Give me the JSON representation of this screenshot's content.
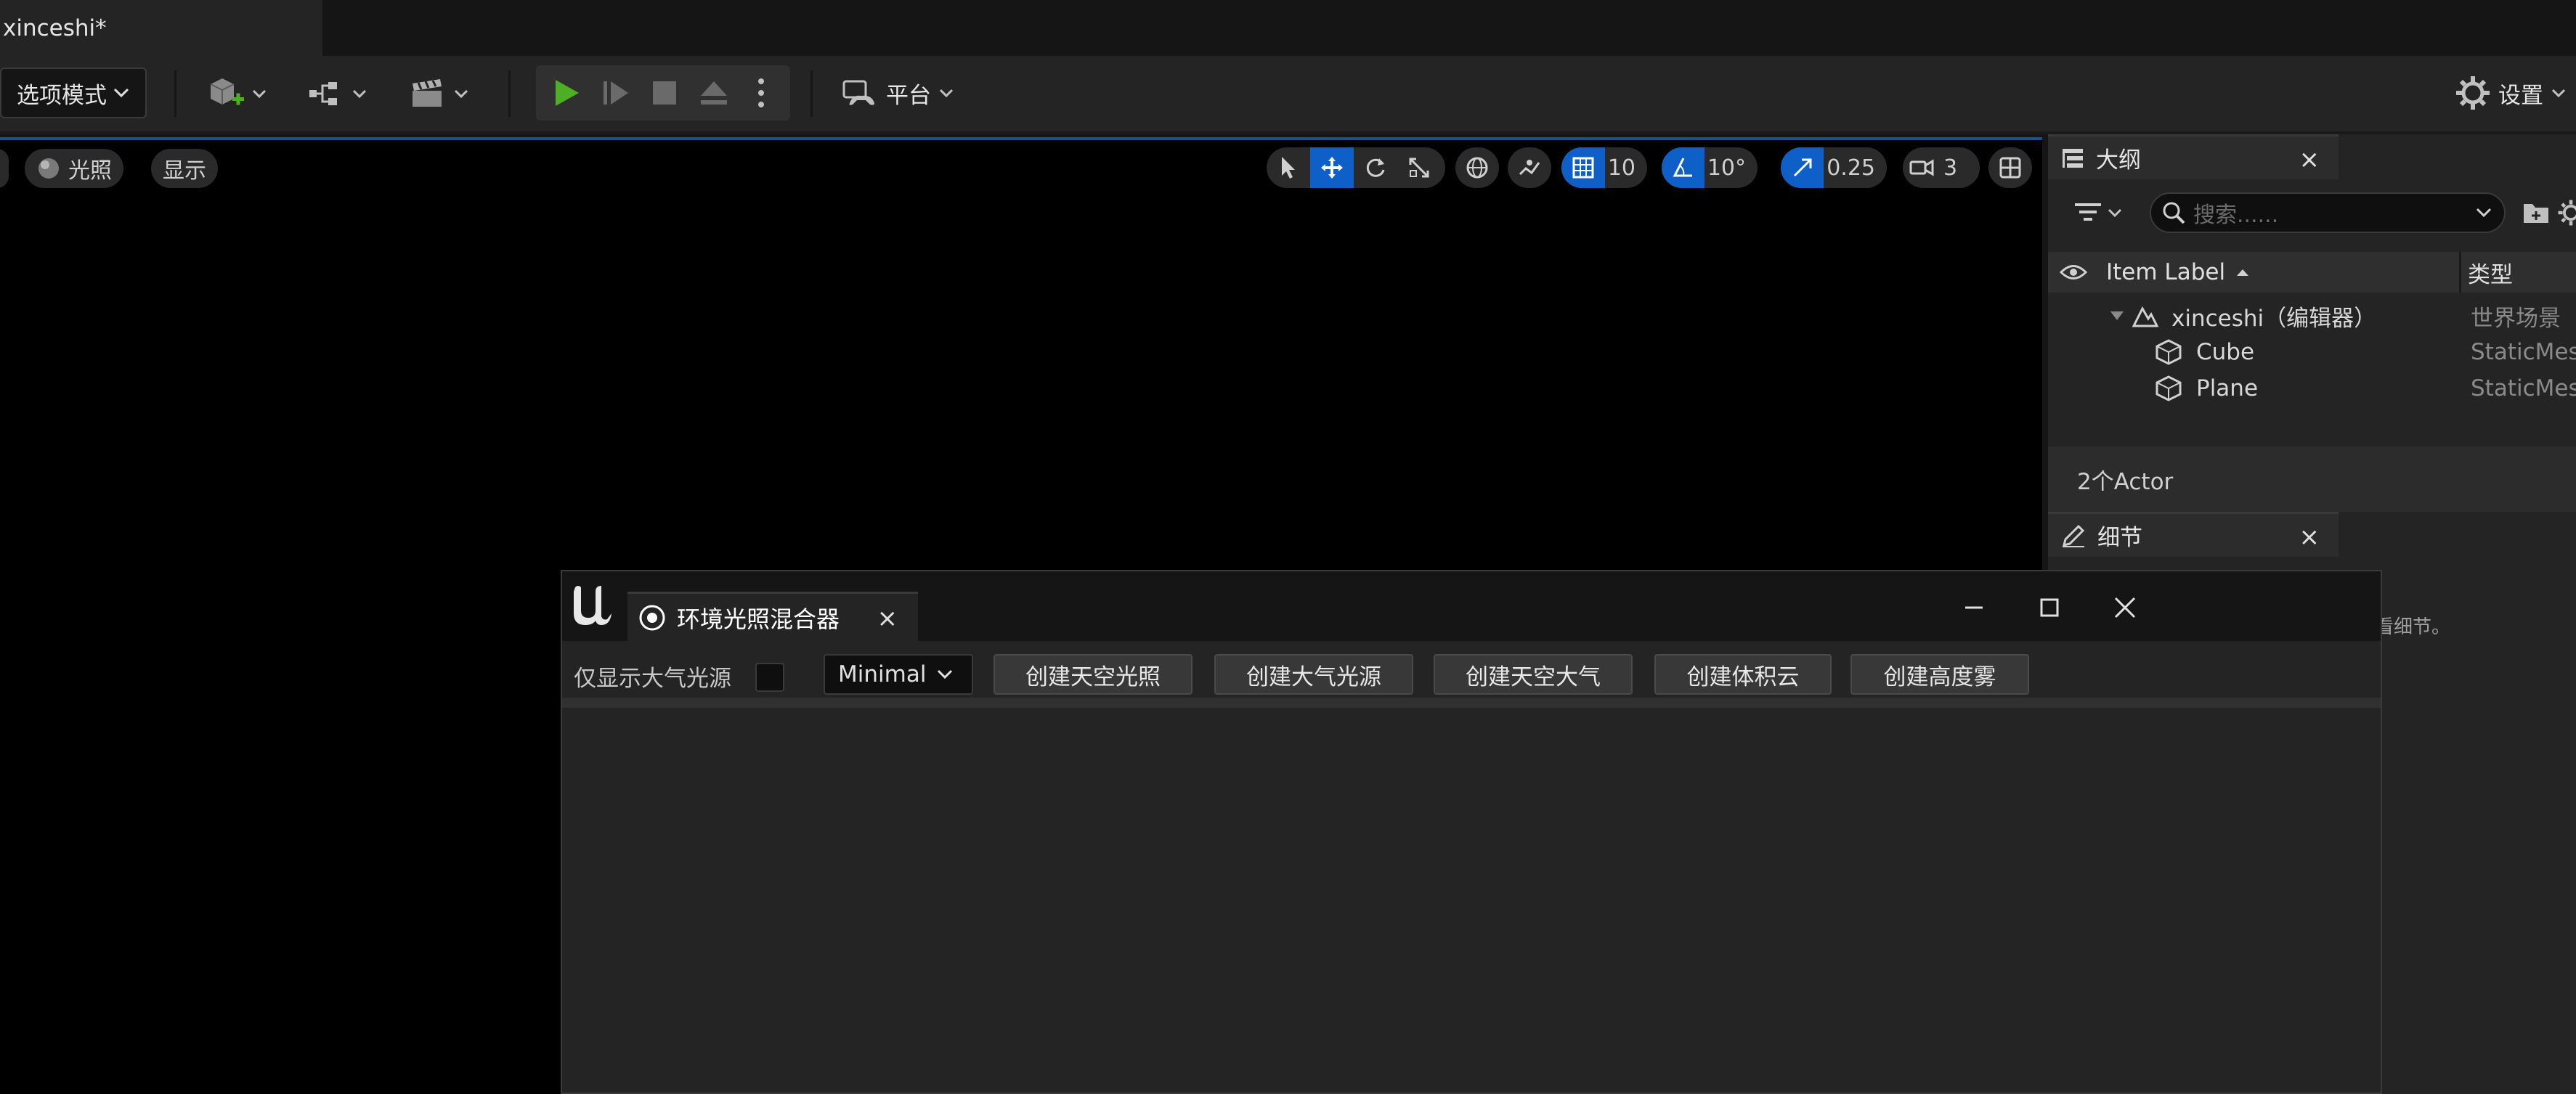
{
  "window": {
    "doc_tab_title": "xinceshi*"
  },
  "toolbar": {
    "mode_label": "选项模式",
    "platform_label": "平台",
    "settings_label": "设置"
  },
  "viewport": {
    "lighting_label": "光照",
    "show_label": "显示",
    "grid_snap_value": "10",
    "rotation_snap_value": "10°",
    "scale_snap_value": "0.25",
    "camera_speed_value": "3"
  },
  "outliner": {
    "tab_label": "大纲",
    "search_placeholder": "搜索......",
    "col_label": "Item Label",
    "col_type": "类型",
    "rows": [
      {
        "label": "xinceshi（编辑器）",
        "type": "世界场景"
      },
      {
        "label": "Cube",
        "type": "StaticMes"
      },
      {
        "label": "Plane",
        "type": "StaticMes"
      }
    ],
    "footer": "2个Actor"
  },
  "details": {
    "tab_label": "细节",
    "empty_text": "看细节。"
  },
  "env_mixer": {
    "tab_label": "环境光照混合器",
    "only_atmos_label": "仅显示大气光源",
    "quality_value": "Minimal",
    "buttons": [
      "创建天空光照",
      "创建大气光源",
      "创建天空大气",
      "创建体积云",
      "创建高度雾"
    ]
  },
  "colors": {
    "accent_blue": "#0e5fc7",
    "play_green": "#4caf24",
    "background_dark": "#151515",
    "panel": "#242424"
  }
}
